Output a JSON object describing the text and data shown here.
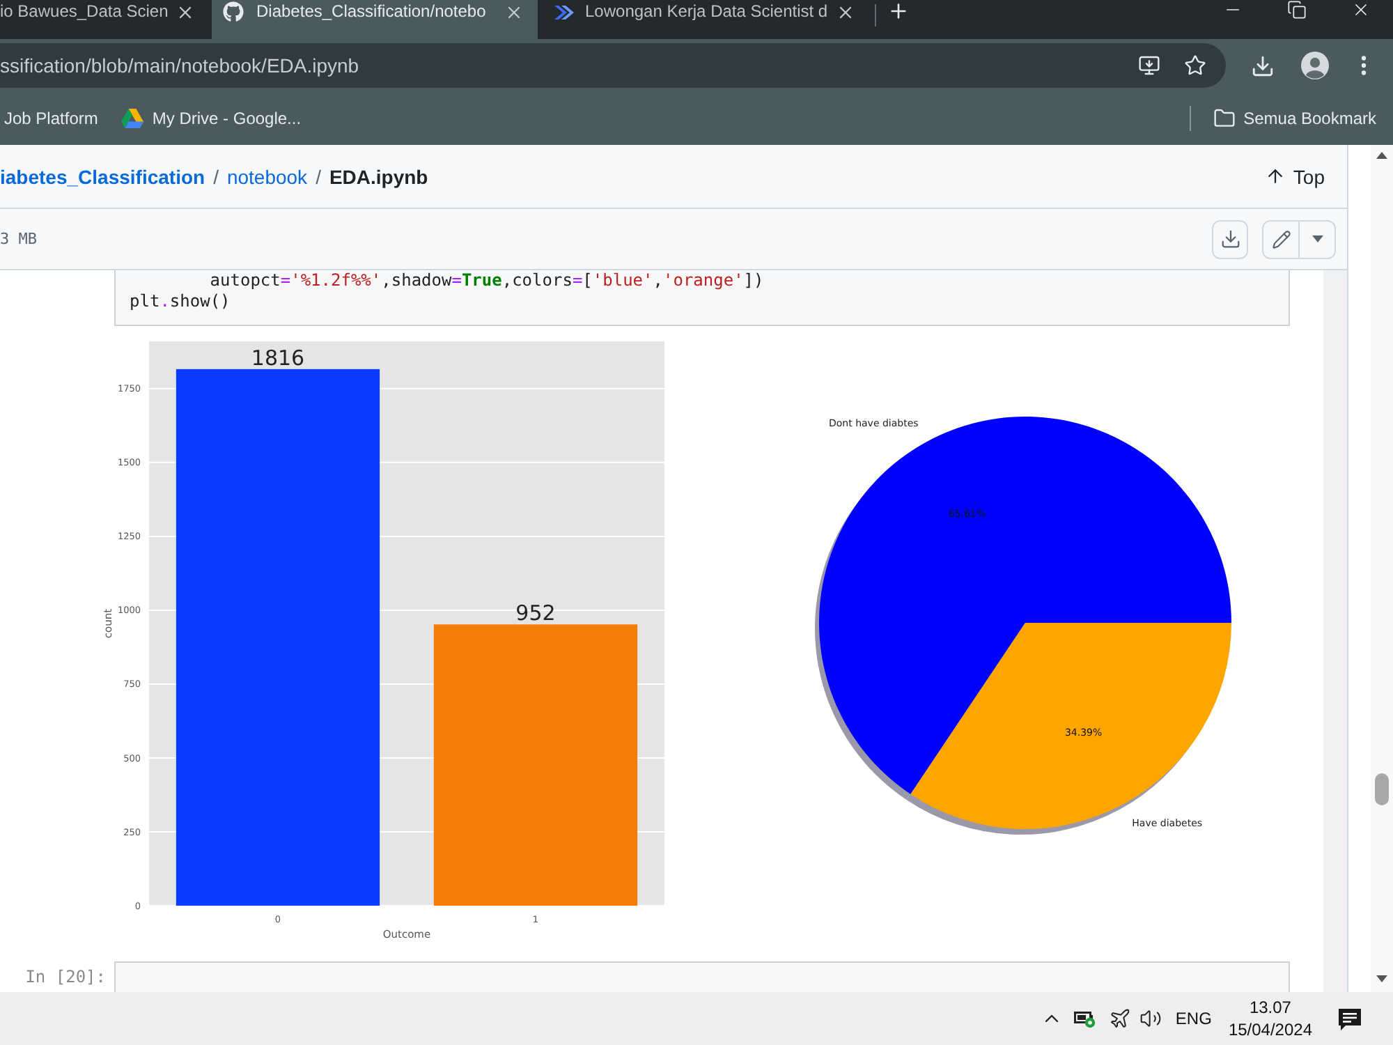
{
  "browser": {
    "tabs": [
      {
        "title": "io Bawues_Data Scien",
        "kind": "plain",
        "selected": false
      },
      {
        "title": "Diabetes_Classification/notebo",
        "kind": "github",
        "selected": true
      },
      {
        "title": "Lowongan Kerja Data Scientist d",
        "kind": "jobsite",
        "selected": false
      }
    ],
    "address": "ssification/blob/main/notebook/EDA.ipynb",
    "bookmarks": [
      {
        "label": "Job Platform",
        "kind": "plain"
      },
      {
        "label": "My Drive - Google...",
        "kind": "drive"
      }
    ],
    "all_bookmarks": "Semua Bookmark"
  },
  "file_header": {
    "breadcrumb": [
      {
        "kind": "repo",
        "text": "iabetes_Classification"
      },
      {
        "kind": "separator",
        "text": "/"
      },
      {
        "kind": "link",
        "text": "notebook"
      },
      {
        "kind": "separator",
        "text": "/"
      },
      {
        "kind": "current",
        "text": "EDA.ipynb"
      }
    ],
    "top_link": "Top",
    "file_size": "3 MB"
  },
  "notebook": {
    "code_cell": {
      "lines": [
        [
          {
            "kind": "plain",
            "text": "        autopct"
          },
          {
            "kind": "operator",
            "text": "="
          },
          {
            "kind": "string",
            "text": "'%1.2f%%'"
          },
          {
            "kind": "plain",
            "text": ",shadow"
          },
          {
            "kind": "operator",
            "text": "="
          },
          {
            "kind": "keyword",
            "text": "True"
          },
          {
            "kind": "plain",
            "text": ",colors"
          },
          {
            "kind": "operator",
            "text": "="
          },
          {
            "kind": "plain",
            "text": "["
          },
          {
            "kind": "string",
            "text": "'blue'"
          },
          {
            "kind": "plain",
            "text": ","
          },
          {
            "kind": "string",
            "text": "'orange'"
          },
          {
            "kind": "plain",
            "text": "])"
          }
        ],
        [
          {
            "kind": "plain",
            "text": "plt"
          },
          {
            "kind": "operator",
            "text": "."
          },
          {
            "kind": "plain",
            "text": "show()"
          }
        ]
      ]
    },
    "bar_chart": {
      "chart_data": {
        "type": "bar",
        "xlabel": "Outcome",
        "ylabel": "count",
        "categories": [
          "0",
          "1"
        ],
        "values": [
          1816,
          952
        ],
        "colors": [
          "#0a3cff",
          "#f77b07"
        ],
        "ylim": [
          0,
          1910
        ],
        "yticks": [
          0,
          250,
          500,
          750,
          1000,
          1250,
          1500,
          1750
        ],
        "grid": true,
        "data_labels": true
      }
    },
    "pie_chart": {
      "chart_data": {
        "type": "pie",
        "categories": [
          "Dont have diabtes",
          "Have diabetes"
        ],
        "values": [
          65.61,
          34.39
        ],
        "colors": [
          "#0000ff",
          "#ffa500"
        ],
        "value_labels": [
          "65.61%",
          "34.39%"
        ]
      }
    },
    "next_cell": {
      "prompt": "In [20]:"
    }
  },
  "taskbar": {
    "language": "ENG",
    "time": "13.07",
    "date": "15/04/2024"
  }
}
